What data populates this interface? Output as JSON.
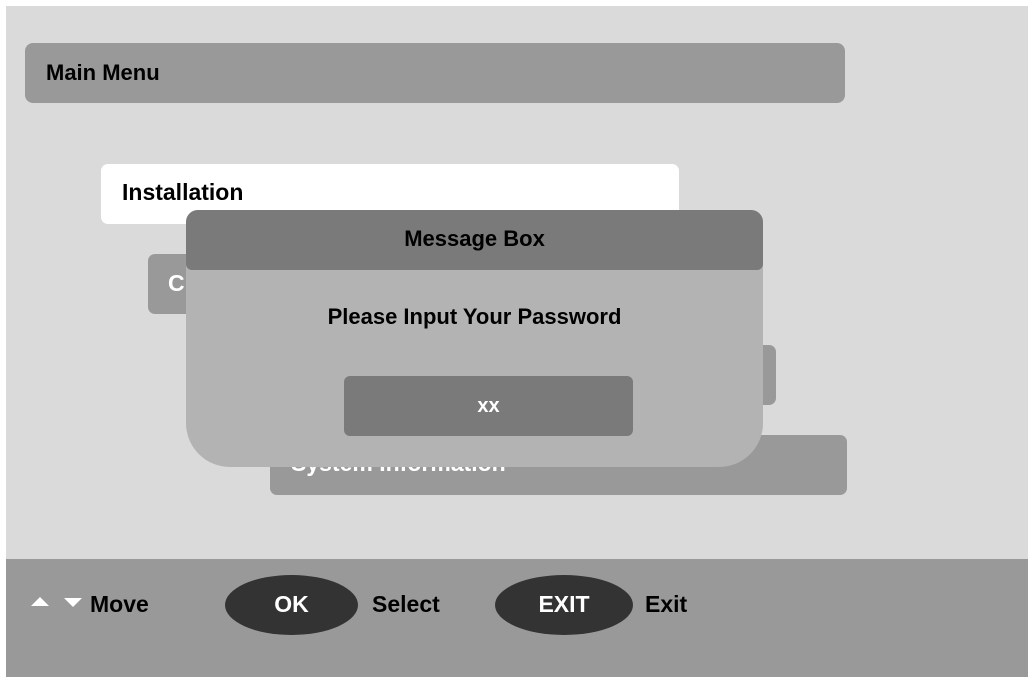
{
  "header": {
    "title": "Main Menu"
  },
  "menu": {
    "items": [
      {
        "label": "Installation"
      },
      {
        "label": "C"
      },
      {
        "label": ""
      },
      {
        "label": "System Information"
      }
    ]
  },
  "message_box": {
    "title": "Message Box",
    "prompt": "Please Input Your Password",
    "password_value": "xx"
  },
  "footer": {
    "move_icons": [
      "arrow-up-icon",
      "arrow-down-icon"
    ],
    "move_label": "Move",
    "ok_key": "OK",
    "select_label": "Select",
    "exit_key": "EXIT",
    "exit_label": "Exit"
  },
  "colors": {
    "background": "#dadada",
    "bar": "#999999",
    "dialog": "#b3b3b3",
    "dialog_header": "#7a7a7a",
    "key_oval": "#333333",
    "selected_item": "#ffffff"
  }
}
